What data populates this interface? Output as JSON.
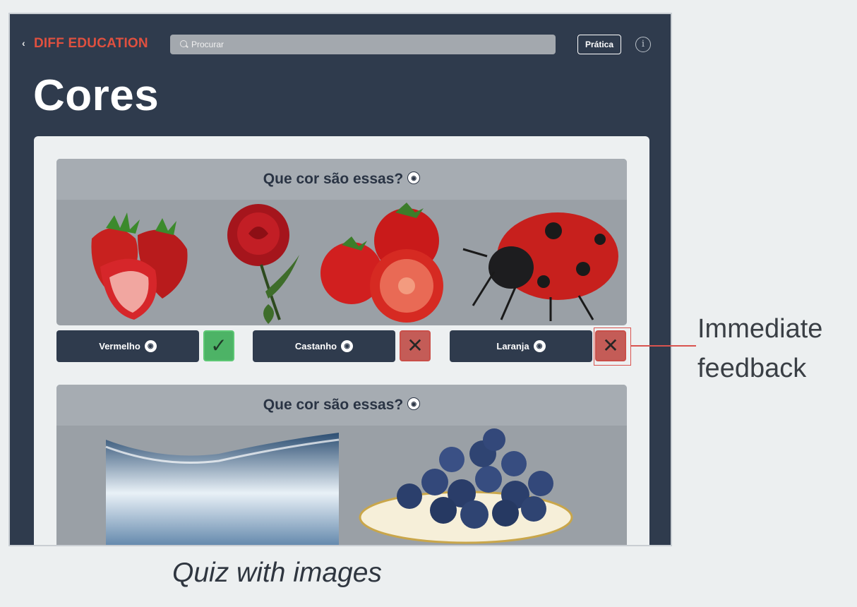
{
  "app": {
    "brand": "DIFF EDUCATION",
    "back_glyph": "‹",
    "search_placeholder": "Procurar",
    "practice_button": "Prática",
    "info_glyph": "i",
    "title": "Cores"
  },
  "quiz": [
    {
      "question": "Que cor são essas?",
      "images": [
        "strawberries",
        "rose",
        "tomatoes",
        "ladybug"
      ],
      "answers": [
        {
          "label": "Vermelho",
          "feedback": "correct",
          "feedback_glyph": "✓"
        },
        {
          "label": "Castanho",
          "feedback": "incorrect",
          "feedback_glyph": "✕"
        },
        {
          "label": "Laranja",
          "feedback": "incorrect",
          "feedback_glyph": "✕"
        }
      ]
    },
    {
      "question": "Que cor são essas?",
      "images": [
        "water-splash",
        "blueberries"
      ]
    }
  ],
  "annotations": {
    "callout": "Immediate feedback",
    "caption": "Quiz with images"
  },
  "colors": {
    "brand": "#e0503f",
    "background": "#2f3b4d",
    "correct": "#4db366",
    "incorrect": "#c45c57"
  }
}
